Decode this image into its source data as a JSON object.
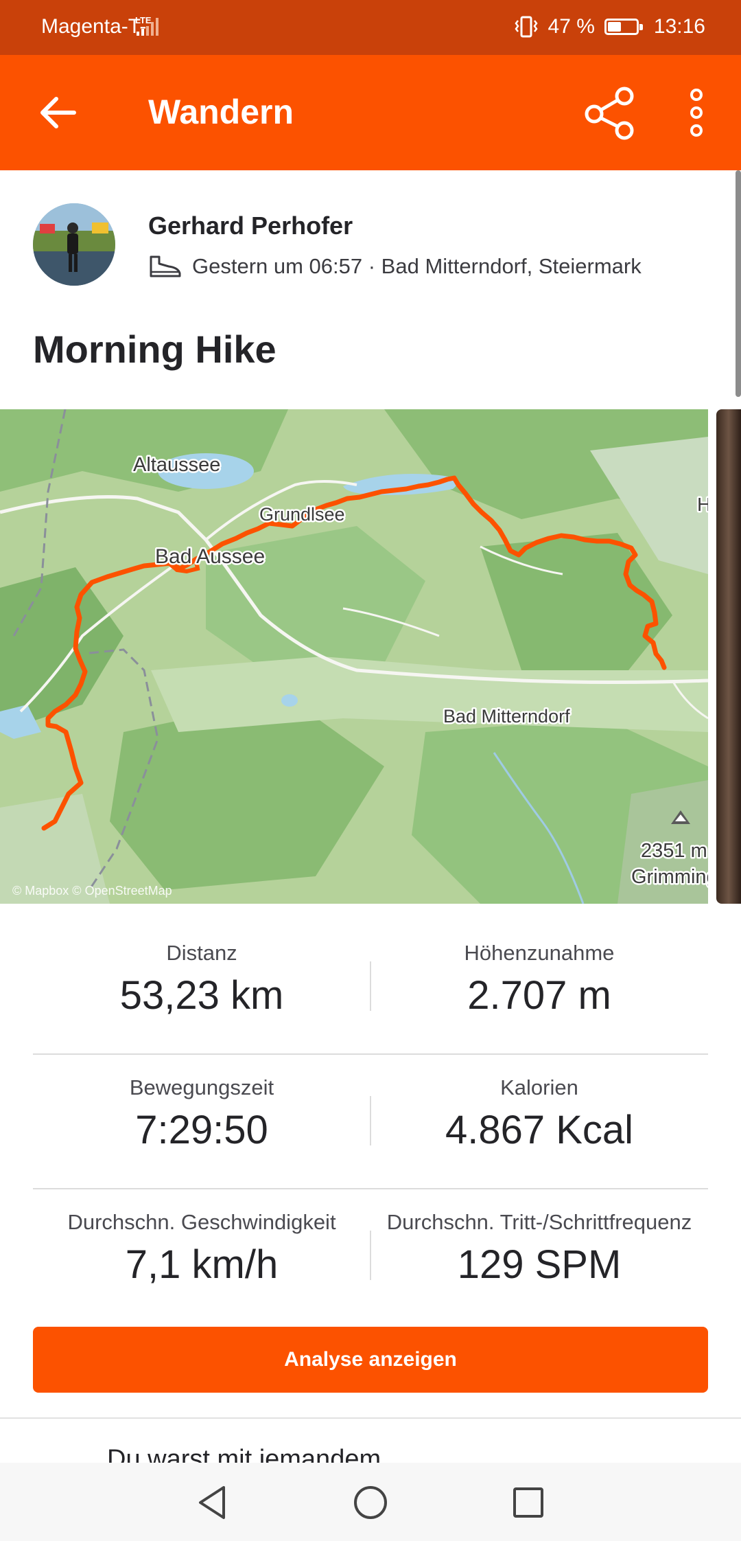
{
  "status_bar": {
    "carrier": "Magenta-T-",
    "network": "LTE",
    "battery_percent": "47 %",
    "battery_level": 0.47,
    "time": "13:16"
  },
  "app_bar": {
    "title": "Wandern",
    "icons": [
      "back-arrow-icon",
      "share-icon",
      "more-vert-icon"
    ]
  },
  "athlete": {
    "name": "Gerhard Perhofer",
    "activity_icon": "hiking-boot-icon",
    "meta": "Gestern um 06:57 · Bad Mitterndorf, Steiermark"
  },
  "activity": {
    "title": "Morning Hike"
  },
  "map": {
    "labels": {
      "altaussee": "Altaussee",
      "grundlsee": "Grundlsee",
      "bad_aussee": "Bad Aussee",
      "bad_mitterndorf": "Bad Mitterndorf",
      "peak_height": "2351 m",
      "peak_name": "Grimming",
      "edge_letter": "H"
    },
    "attribution": "© Mapbox © OpenStreetMap",
    "route_color": "#fc5200"
  },
  "stats": [
    {
      "label": "Distanz",
      "value": "53,23 km"
    },
    {
      "label": "Höhenzunahme",
      "value": "2.707 m"
    },
    {
      "label": "Bewegungszeit",
      "value": "7:29:50"
    },
    {
      "label": "Kalorien",
      "value": "4.867 Kcal"
    },
    {
      "label": "Durchschn. Geschwindigkeit",
      "value": "7,1 km/h"
    },
    {
      "label": "Durchschn. Tritt-/Schrittfrequenz",
      "value": "129 SPM"
    }
  ],
  "cta": {
    "label": "Analyse anzeigen"
  },
  "next_section": {
    "text": "Du warst mit jemandem"
  },
  "nav_bar": {
    "icons": [
      "nav-back-icon",
      "nav-home-icon",
      "nav-recents-icon"
    ]
  },
  "colors": {
    "brand": "#fc5200",
    "status_bar": "#c9410a"
  }
}
